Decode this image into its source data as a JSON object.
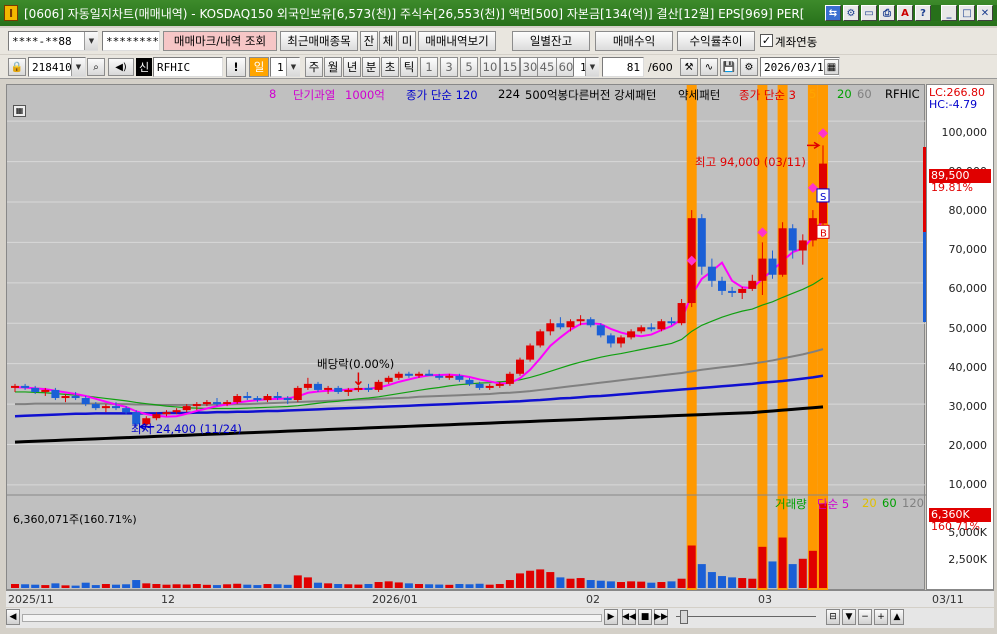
{
  "window": {
    "icon_glyph": "I",
    "title": "[0606] 자동일지차트(매매내역) - KOSDAQ150 외국인보유[6,573(천)] 주식수[26,553(천)] 액면[500] 자본금[134(억)] 결산[12월] EPS[969] PER[",
    "buttons": [
      "minimize-box-icon",
      "restore-icon",
      "maximize-icon",
      "close-icon"
    ]
  },
  "toolbar1": {
    "account": "****-**88",
    "password": "********",
    "mark_btn": "매매마크/내역 조회",
    "recent_btn": "최근매매종목",
    "j_btn": "잔",
    "c_btn": "체",
    "m_btn": "미",
    "history_btn": "매매내역보기",
    "daily_btn": "일별잔고",
    "profit_btn": "매매수익",
    "rate_btn": "수익률추이",
    "account_link_label": "계좌연동",
    "account_link_checked": "✓"
  },
  "toolbar2": {
    "code": "218410",
    "stock_name": "RFHIC",
    "sin": "신",
    "period_sel": "일",
    "period_num": "1",
    "periods": [
      "주",
      "월",
      "년",
      "분",
      "초",
      "틱"
    ],
    "intervals": [
      "1",
      "3",
      "5",
      "10",
      "15",
      "30",
      "45",
      "60"
    ],
    "interval_sel": "1",
    "count": "81",
    "count_total": "/600",
    "date": "2026/03/11",
    "bang": "!"
  },
  "legend": {
    "items": [
      {
        "text": "8",
        "color": "#d000d0"
      },
      {
        "text": "단기과열",
        "color": "#d000d0"
      },
      {
        "text": "1000억",
        "color": "#d000d0"
      },
      {
        "text": "종가 단순 120",
        "color": "#0000cc"
      },
      {
        "text": "224",
        "color": "#000000"
      },
      {
        "text": "500억봉다른버전 강세패턴",
        "color": "#000000"
      },
      {
        "text": "약세패턴",
        "color": "#000000"
      },
      {
        "text": "종가 단순 3",
        "color": "#e00000"
      },
      {
        "text": "5",
        "color": "#ffa500"
      },
      {
        "text": "20",
        "color": "#00a000"
      },
      {
        "text": "60",
        "color": "#808080"
      },
      {
        "text": "RFHIC",
        "color": "#000000"
      }
    ],
    "lc": "LC:266.80",
    "hc": "HC:-4.79"
  },
  "annotations": {
    "high": "최고 94,000 (03/11)",
    "low": "최저 24,400 (11/24)",
    "dividend": "배당락(0.00%)",
    "sell_mark": "S",
    "buy_mark": "B"
  },
  "price_axis": {
    "labels": [
      "100,000",
      "90,000",
      "80,000",
      "70,000",
      "60,000",
      "50,000",
      "40,000",
      "30,000",
      "20,000",
      "10,000"
    ],
    "current": "89,500",
    "change": "19.81%"
  },
  "volume": {
    "caption": "6,360,071주(160.71%)",
    "legend": [
      {
        "text": "거래량",
        "color": "#00a000"
      },
      {
        "text": "단순 5",
        "color": "#d000d0"
      },
      {
        "text": "20",
        "color": "#e0c000"
      },
      {
        "text": "60",
        "color": "#00a000"
      },
      {
        "text": "120",
        "color": "#808080"
      }
    ],
    "axis_labels": [
      "5,000K",
      "2,500K"
    ],
    "current": "6,360K",
    "change": "160.71%"
  },
  "time_axis": {
    "labels": [
      "2025/11",
      "12",
      "2026/01",
      "02",
      "03"
    ],
    "right": "03/11"
  },
  "chart_data": {
    "type": "candlestick",
    "y_range": [
      8000,
      104000
    ],
    "unit": "원",
    "candles": [
      [
        34000,
        35000,
        33000,
        34500
      ],
      [
        34500,
        35000,
        33500,
        34000
      ],
      [
        34000,
        34500,
        32500,
        33000
      ],
      [
        33000,
        34000,
        32000,
        33500
      ],
      [
        33500,
        34000,
        31000,
        31500
      ],
      [
        31500,
        32500,
        30500,
        32000
      ],
      [
        32000,
        33000,
        31000,
        31500
      ],
      [
        31500,
        32000,
        29500,
        30000
      ],
      [
        30000,
        30500,
        28500,
        29000
      ],
      [
        29000,
        30000,
        28000,
        29500
      ],
      [
        29500,
        30500,
        28500,
        29000
      ],
      [
        29000,
        29500,
        27500,
        28000
      ],
      [
        28000,
        28500,
        24400,
        25000
      ],
      [
        25000,
        27000,
        24500,
        26500
      ],
      [
        26500,
        28000,
        26000,
        27500
      ],
      [
        27500,
        28500,
        27000,
        28000
      ],
      [
        28000,
        29000,
        27500,
        28500
      ],
      [
        28500,
        30000,
        28000,
        29500
      ],
      [
        29500,
        30500,
        28500,
        30000
      ],
      [
        30000,
        31000,
        29500,
        30500
      ],
      [
        30500,
        31500,
        29500,
        30000
      ],
      [
        30000,
        31000,
        29500,
        30500
      ],
      [
        30500,
        32500,
        30000,
        32000
      ],
      [
        32000,
        33000,
        31000,
        31500
      ],
      [
        31500,
        32000,
        30500,
        31000
      ],
      [
        31000,
        32500,
        30500,
        32000
      ],
      [
        32000,
        33000,
        31000,
        31500
      ],
      [
        31500,
        32000,
        30000,
        31000
      ],
      [
        31000,
        34500,
        30500,
        34000
      ],
      [
        34000,
        36500,
        33500,
        35000
      ],
      [
        35000,
        35500,
        33000,
        33500
      ],
      [
        33500,
        34500,
        32500,
        34000
      ],
      [
        34000,
        34500,
        32500,
        33000
      ],
      [
        33000,
        34000,
        32000,
        33500
      ],
      [
        33500,
        34500,
        33000,
        34000
      ],
      [
        34000,
        35000,
        33000,
        33500
      ],
      [
        33500,
        36000,
        33000,
        35500
      ],
      [
        35500,
        37000,
        35000,
        36500
      ],
      [
        36500,
        38000,
        36000,
        37500
      ],
      [
        37500,
        38000,
        36500,
        37000
      ],
      [
        37000,
        38000,
        36500,
        37500
      ],
      [
        37500,
        38500,
        37000,
        37000
      ],
      [
        37000,
        37500,
        36000,
        36500
      ],
      [
        36500,
        37500,
        36000,
        37000
      ],
      [
        37000,
        37500,
        35500,
        36000
      ],
      [
        36000,
        36500,
        34500,
        35000
      ],
      [
        35000,
        35500,
        33500,
        34000
      ],
      [
        34000,
        35000,
        33500,
        34500
      ],
      [
        34500,
        35500,
        34000,
        35000
      ],
      [
        35000,
        38000,
        34500,
        37500
      ],
      [
        37500,
        41500,
        37000,
        41000
      ],
      [
        41000,
        45000,
        40500,
        44500
      ],
      [
        44500,
        48500,
        44000,
        48000
      ],
      [
        48000,
        51000,
        47000,
        50000
      ],
      [
        50000,
        51500,
        48500,
        49000
      ],
      [
        49000,
        51000,
        48000,
        50500
      ],
      [
        50500,
        52000,
        49500,
        51000
      ],
      [
        51000,
        51500,
        49000,
        49500
      ],
      [
        49500,
        50000,
        46500,
        47000
      ],
      [
        47000,
        47500,
        44000,
        45000
      ],
      [
        45000,
        47000,
        44000,
        46500
      ],
      [
        46500,
        48500,
        46000,
        48000
      ],
      [
        48000,
        49500,
        47500,
        49000
      ],
      [
        49000,
        50000,
        48000,
        48500
      ],
      [
        48500,
        51000,
        48000,
        50500
      ],
      [
        50500,
        51500,
        49500,
        50000
      ],
      [
        50000,
        56000,
        49500,
        55000
      ],
      [
        55000,
        78000,
        54000,
        76000
      ],
      [
        76000,
        77000,
        62000,
        64000
      ],
      [
        64000,
        66000,
        59000,
        60500
      ],
      [
        60500,
        61500,
        57000,
        58000
      ],
      [
        58000,
        59000,
        56500,
        57500
      ],
      [
        57500,
        59000,
        56000,
        58500
      ],
      [
        58500,
        62000,
        58000,
        60500
      ],
      [
        60500,
        70000,
        57000,
        66000
      ],
      [
        66000,
        68000,
        61000,
        62000
      ],
      [
        62000,
        75000,
        61500,
        73500
      ],
      [
        73500,
        74500,
        66000,
        68000
      ],
      [
        68000,
        72000,
        64500,
        70500
      ],
      [
        70500,
        78000,
        69000,
        76000
      ],
      [
        74700,
        94000,
        74000,
        89500
      ]
    ],
    "volumes": [
      30,
      28,
      25,
      22,
      35,
      20,
      18,
      40,
      22,
      30,
      25,
      28,
      60,
      35,
      30,
      25,
      28,
      26,
      30,
      24,
      22,
      28,
      32,
      25,
      22,
      30,
      28,
      24,
      95,
      80,
      40,
      35,
      30,
      28,
      26,
      30,
      45,
      50,
      42,
      35,
      30,
      28,
      26,
      24,
      30,
      28,
      32,
      25,
      30,
      60,
      110,
      130,
      140,
      120,
      80,
      70,
      75,
      60,
      55,
      50,
      45,
      50,
      48,
      40,
      45,
      50,
      70,
      320,
      180,
      120,
      90,
      80,
      75,
      70,
      310,
      200,
      380,
      180,
      220,
      280,
      637
    ],
    "ma5": [
      34200,
      34100,
      33900,
      33700,
      33300,
      32900,
      32500,
      32000,
      31300,
      30600,
      29900,
      29300,
      28200,
      27500,
      27100,
      26900,
      27000,
      27600,
      28300,
      28900,
      29500,
      29900,
      30400,
      30700,
      31000,
      31200,
      31300,
      31400,
      31900,
      32800,
      33100,
      33300,
      33400,
      33600,
      33700,
      33800,
      34100,
      34700,
      35500,
      36100,
      36700,
      37100,
      37200,
      37300,
      37100,
      36700,
      36100,
      35600,
      35100,
      35200,
      36400,
      38500,
      41300,
      44400,
      46500,
      48400,
      49800,
      50000,
      49800,
      48600,
      47700,
      47100,
      46800,
      47200,
      48300,
      49300,
      51000,
      57000,
      61000,
      62900,
      65000,
      60500,
      58900,
      58700,
      61000,
      63100,
      65400,
      67600,
      68500,
      71300,
      75800
    ],
    "ma20": [
      33000,
      33000,
      32900,
      32800,
      32600,
      32400,
      32200,
      32000,
      31700,
      31400,
      31100,
      30800,
      30400,
      30100,
      29800,
      29500,
      29300,
      29100,
      29000,
      28900,
      28900,
      28900,
      28900,
      29000,
      29100,
      29200,
      29300,
      29400,
      29600,
      29900,
      30200,
      30500,
      30700,
      31000,
      31300,
      31500,
      31800,
      32200,
      32600,
      33000,
      33400,
      33800,
      34100,
      34500,
      34800,
      35000,
      35200,
      35300,
      35500,
      35700,
      36000,
      36600,
      37300,
      38100,
      38900,
      39700,
      40400,
      41000,
      41600,
      42100,
      42500,
      43000,
      43500,
      44000,
      44500,
      45000,
      46000,
      48000,
      49500,
      50500,
      51500,
      52300,
      53000,
      53500,
      54500,
      55300,
      56400,
      57400,
      58400,
      59600,
      61200
    ],
    "ma60": [
      30000,
      30000,
      30100,
      30100,
      30100,
      30100,
      30100,
      30100,
      30100,
      30100,
      30000,
      30000,
      29900,
      29900,
      29800,
      29800,
      29800,
      29800,
      29800,
      29800,
      29900,
      29900,
      30000,
      30000,
      30100,
      30200,
      30300,
      30400,
      30500,
      30600,
      30700,
      30800,
      30900,
      31000,
      31100,
      31200,
      31300,
      31400,
      31500,
      31600,
      31800,
      31900,
      32000,
      32100,
      32200,
      32300,
      32400,
      32500,
      32700,
      32800,
      33000,
      33200,
      33500,
      33800,
      34100,
      34400,
      34700,
      35000,
      35300,
      35600,
      35900,
      36200,
      36500,
      36800,
      37100,
      37400,
      37700,
      38100,
      38500,
      38800,
      39100,
      39400,
      39700,
      40000,
      40400,
      40800,
      41300,
      41800,
      42300,
      42900,
      43600
    ],
    "ma120": [
      27000,
      27100,
      27200,
      27300,
      27400,
      27500,
      27600,
      27600,
      27700,
      27700,
      27700,
      27700,
      27700,
      27700,
      27700,
      27800,
      27800,
      27800,
      27900,
      27900,
      28000,
      28000,
      28100,
      28100,
      28200,
      28300,
      28300,
      28400,
      28500,
      28600,
      28700,
      28800,
      28900,
      29000,
      29100,
      29200,
      29300,
      29400,
      29500,
      29600,
      29700,
      29800,
      29900,
      30000,
      30100,
      30200,
      30300,
      30400,
      30500,
      30600,
      30700,
      30900,
      31000,
      31200,
      31400,
      31500,
      31700,
      31900,
      32000,
      32200,
      32400,
      32600,
      32800,
      33000,
      33200,
      33400,
      33600,
      33800,
      34000,
      34200,
      34400,
      34600,
      34800,
      35000,
      35300,
      35500,
      35700,
      36000,
      36300,
      36600,
      37000
    ],
    "ma224": [
      20600,
      20700,
      20800,
      20900,
      21000,
      21100,
      21200,
      21300,
      21400,
      21500,
      21600,
      21700,
      21800,
      21900,
      22000,
      22100,
      22200,
      22300,
      22400,
      22500,
      22600,
      22700,
      22800,
      22900,
      23000,
      23100,
      23200,
      23300,
      23400,
      23500,
      23600,
      23700,
      23800,
      23900,
      24000,
      24100,
      24200,
      24300,
      24400,
      24500,
      24600,
      24700,
      24800,
      24900,
      25000,
      25100,
      25200,
      25300,
      25400,
      25500,
      25600,
      25700,
      25800,
      25900,
      26000,
      26100,
      26200,
      26300,
      26400,
      26500,
      26600,
      26700,
      26800,
      26900,
      27000,
      27100,
      27200,
      27300,
      27400,
      27500,
      27600,
      27700,
      27800,
      27900,
      28100,
      28300,
      28500,
      28700,
      28900,
      29100,
      29300
    ],
    "highlight_bars": [
      67,
      74,
      76,
      79,
      80
    ],
    "pink_diamonds": [
      [
        67,
        65500
      ],
      [
        74,
        72500
      ],
      [
        79,
        83500
      ],
      [
        80,
        97000
      ]
    ],
    "sell_at": [
      80,
      81500
    ],
    "buy_at": [
      80,
      72500
    ]
  },
  "colors": {
    "title_bg": "#2c7a1f",
    "up": "#e00000",
    "down": "#1a5fd6",
    "highlight": "#ff9900",
    "chart_bg": "#c0c0c0"
  }
}
